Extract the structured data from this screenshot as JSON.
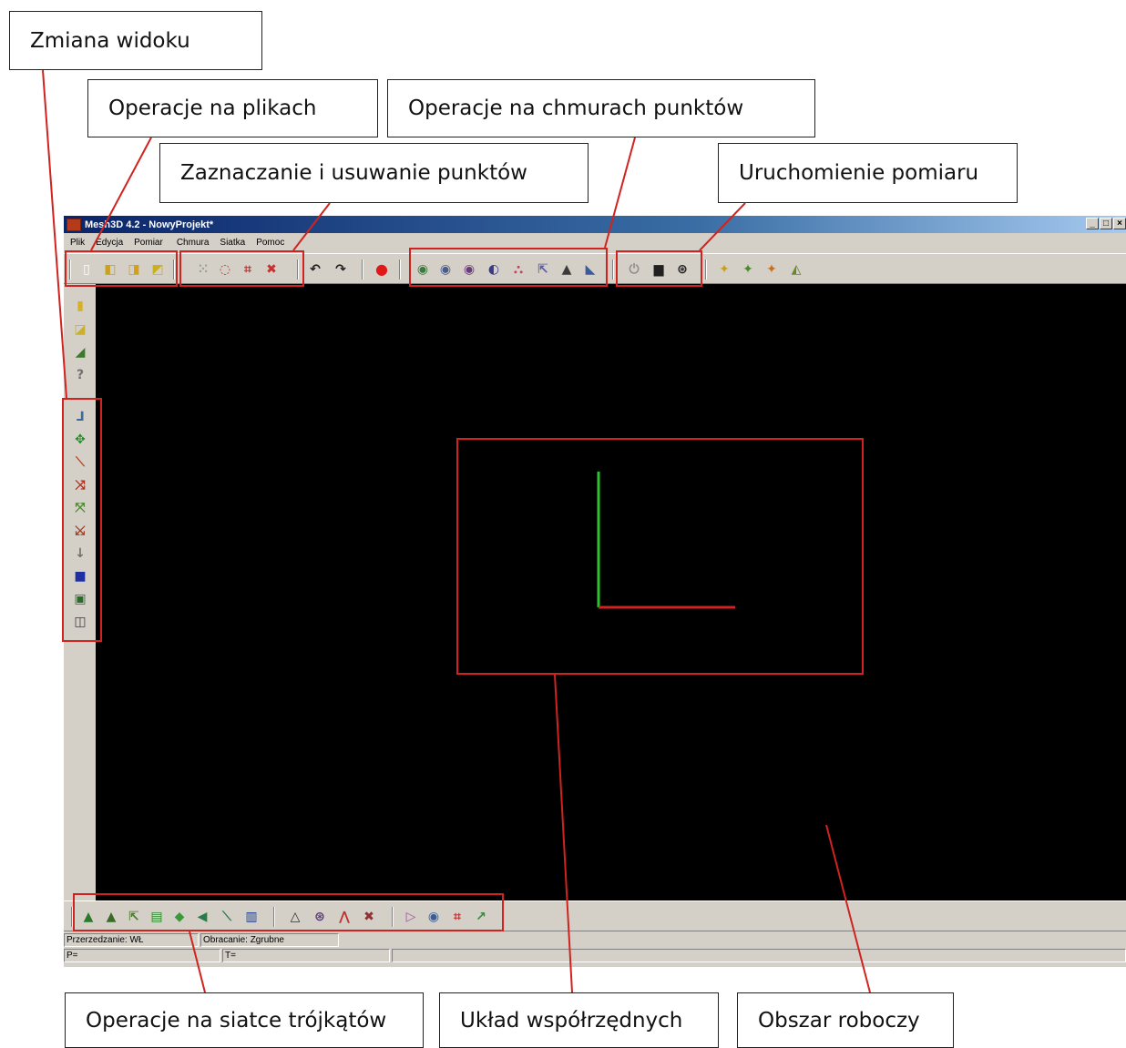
{
  "callouts": {
    "view_change": "Zmiana widoku",
    "file_ops": "Operacje na plikach",
    "point_cloud_ops": "Operacje na chmurach punktów",
    "select_delete": "Zaznaczanie i usuwanie punktów",
    "start_measure": "Uruchomienie pomiaru",
    "mesh_ops": "Operacje na siatce trójkątów",
    "coord_system": "Układ współrzędnych",
    "work_area": "Obszar roboczy"
  },
  "window": {
    "title": "Mesh3D 4.2 - NowyProjekt*",
    "buttons": [
      "_",
      "□",
      "×"
    ]
  },
  "menu": [
    "Plik",
    "Edycja",
    "Pomiar",
    "Chmura",
    "Siatka",
    "Pomoc"
  ],
  "status": {
    "thinning": "Przerzedzanie: WŁ",
    "rotation": "Obracanie: Zgrubne",
    "p": "P=",
    "t": "T="
  },
  "colors": {
    "annotation": "#d0231f",
    "axis_y": "#2fc22f",
    "axis_x": "#d02222",
    "viewport": "#000000"
  },
  "icons": {
    "toolbar": [
      "new-file-icon",
      "open-file-icon",
      "save-file-icon",
      "save-as-icon",
      "select-points-icon",
      "lasso-icon",
      "select-box-icon",
      "delete-points-icon",
      "undo-icon",
      "redo-icon",
      "stop-icon",
      "cloud-op-1-icon",
      "cloud-op-2-icon",
      "cloud-op-3-icon",
      "cloud-op-4-icon",
      "cloud-filter-icon",
      "cloud-align-icon",
      "cloud-mesh-icon",
      "cloud-color-icon",
      "power-icon",
      "camera-icon",
      "scan-icon",
      "extra-1-icon",
      "extra-2-icon",
      "extra-3-icon",
      "extra-4-icon"
    ],
    "left": [
      "view-1-icon",
      "view-2-icon",
      "view-3-icon",
      "help-icon",
      "axes-icon",
      "move-icon",
      "line-icon",
      "rotate-x-icon",
      "rotate-y-icon",
      "rotate-z-icon",
      "pan-icon",
      "cube-solid-icon",
      "cube-wire-icon",
      "cube-front-icon"
    ],
    "bottom": [
      "mesh-1-icon",
      "mesh-2-icon",
      "mesh-3-icon",
      "mesh-4-icon",
      "mesh-5-icon",
      "mesh-6-icon",
      "mesh-7-icon",
      "mesh-8-icon",
      "mesh-9-icon",
      "mesh-10-icon",
      "mesh-11-icon",
      "mesh-12-icon",
      "mesh-13-icon",
      "mesh-14-icon",
      "mesh-15-icon",
      "mesh-16-icon"
    ]
  }
}
